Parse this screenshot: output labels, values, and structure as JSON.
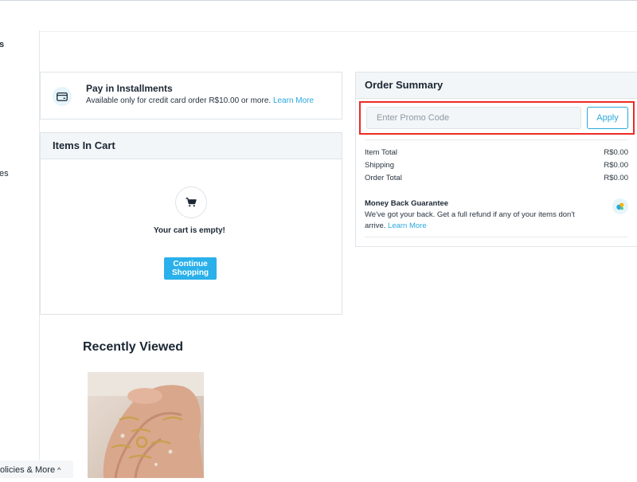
{
  "sidebar": {
    "item_top_fragment": "s",
    "item_mid_fragment": "es"
  },
  "installments": {
    "title": "Pay in Installments",
    "text": "Available only for credit card order R$10.00 or more.",
    "link": "Learn More",
    "icon": "credit-card-icon"
  },
  "cart": {
    "heading": "Items In Cart",
    "empty_text": "Your cart is empty!",
    "continue_label": "Continue Shopping",
    "icon": "shopping-cart-icon",
    "accent": "#2ab0ea"
  },
  "summary": {
    "heading": "Order Summary",
    "promo_placeholder": "Enter Promo Code",
    "apply_label": "Apply",
    "highlight_color": "#ee2a24",
    "rows": [
      {
        "label": "Item Total",
        "value": "R$0.00"
      },
      {
        "label": "Shipping",
        "value": "R$0.00"
      },
      {
        "label": "Order Total",
        "value": "R$0.00"
      }
    ],
    "guarantee_title": "Money Back Guarantee",
    "guarantee_text": "We've got your back. Get a full refund if any of your items don't arrive.",
    "guarantee_link": "Learn More"
  },
  "recently_viewed": {
    "heading": "Recently Viewed"
  },
  "footer": {
    "policies_label": "olicies & More",
    "chevron": "^"
  }
}
